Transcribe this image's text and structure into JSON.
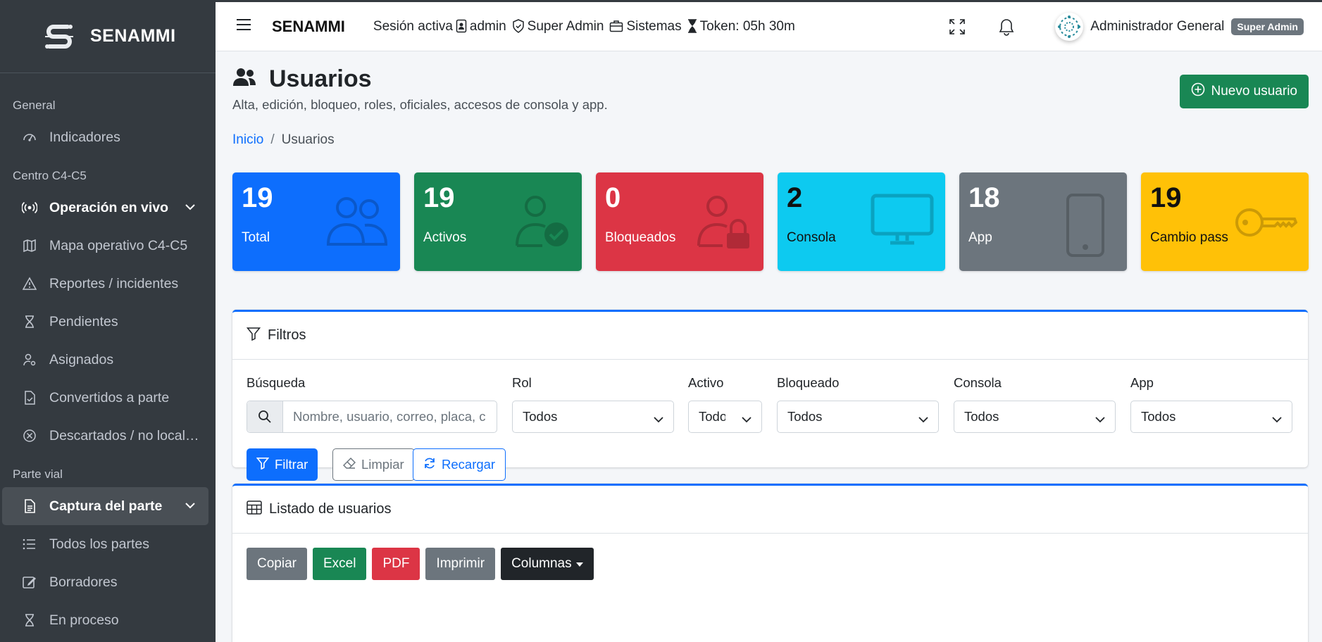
{
  "brand": {
    "name": "SENAMMI"
  },
  "sidebar": {
    "sections": [
      {
        "header": "General",
        "items": [
          {
            "label": "Indicadores",
            "icon": "gauge-icon"
          }
        ]
      },
      {
        "header": "Centro C4-C5",
        "items": [
          {
            "label": "Operación en vivo",
            "icon": "broadcast-icon",
            "expandable": true
          },
          {
            "label": "Mapa operativo C4-C5",
            "icon": "map-icon"
          },
          {
            "label": "Reportes / incidentes",
            "icon": "warning-icon"
          },
          {
            "label": "Pendientes",
            "icon": "hourglass-icon"
          },
          {
            "label": "Asignados",
            "icon": "person-gear-icon"
          },
          {
            "label": "Convertidos a parte",
            "icon": "file-check-icon"
          },
          {
            "label": "Descartados / no localizados",
            "icon": "x-circle-icon"
          }
        ]
      },
      {
        "header": "Parte vial",
        "items": [
          {
            "label": "Captura del parte",
            "icon": "document-icon",
            "expandable": true,
            "active": true
          },
          {
            "label": "Todos los partes",
            "icon": "list-icon"
          },
          {
            "label": "Borradores",
            "icon": "pencil-square-icon"
          },
          {
            "label": "En proceso",
            "icon": "hourglass-icon"
          }
        ]
      }
    ]
  },
  "topbar": {
    "app_title": "SENAMMI",
    "session_label": "Sesión activa",
    "username": "admin",
    "role": "Super Admin",
    "area": "Sistemas",
    "token": "Token: 05h 30m",
    "user_display": "Administrador General",
    "user_badge": "Super Admin"
  },
  "page": {
    "title": "Usuarios",
    "subtitle": "Alta, edición, bloqueo, roles, oficiales, accesos de consola y app.",
    "new_button": "Nuevo usuario",
    "breadcrumb": {
      "home": "Inicio",
      "current": "Usuarios"
    }
  },
  "stats": [
    {
      "value": "19",
      "label": "Total",
      "color": "#0d6efd",
      "icon": "people-icon"
    },
    {
      "value": "19",
      "label": "Activos",
      "color": "#198754",
      "icon": "person-check-icon"
    },
    {
      "value": "0",
      "label": "Bloqueados",
      "color": "#dc3545",
      "icon": "person-lock-icon"
    },
    {
      "value": "2",
      "label": "Consola",
      "color": "#0dcaf0",
      "icon": "monitor-icon"
    },
    {
      "value": "18",
      "label": "App",
      "color": "#6c757d",
      "icon": "phone-icon"
    },
    {
      "value": "19",
      "label": "Cambio pass",
      "color": "#ffc107",
      "icon": "key-icon"
    }
  ],
  "filters": {
    "title": "Filtros",
    "search": {
      "label": "Búsqueda",
      "placeholder": "Nombre, usuario, correo, placa, c"
    },
    "rol": {
      "label": "Rol",
      "value": "Todos"
    },
    "activo": {
      "label": "Activo",
      "value": "Todos"
    },
    "bloqueado": {
      "label": "Bloqueado",
      "value": "Todos"
    },
    "consola": {
      "label": "Consola",
      "value": "Todos"
    },
    "app": {
      "label": "App",
      "value": "Todos"
    },
    "btn_filtrar": "Filtrar",
    "btn_limpiar": "Limpiar",
    "btn_recargar": "Recargar"
  },
  "listing": {
    "title": "Listado de usuarios",
    "buttons": {
      "copy": "Copiar",
      "excel": "Excel",
      "pdf": "PDF",
      "print": "Imprimir",
      "columns": "Columnas"
    }
  }
}
